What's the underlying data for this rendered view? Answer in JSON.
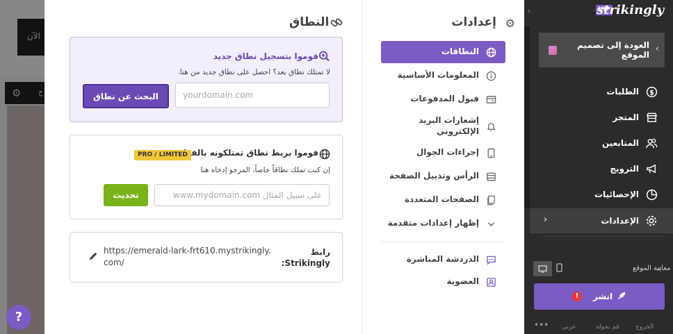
{
  "background": {
    "now_text": "الآن",
    "side_text": "ح"
  },
  "help": {
    "label": "?"
  },
  "settings": {
    "title": "إعدادات",
    "nav": [
      {
        "label": "النطاقات",
        "icon": "globe-icon",
        "active": true
      },
      {
        "label": "المعلومات الأساسية",
        "icon": "info-icon"
      },
      {
        "label": "قبول المدفوعات",
        "icon": "card-icon"
      },
      {
        "label": "إشعارات البريد الإلكتروني",
        "icon": "bell-icon"
      },
      {
        "label": "إجراءات الجوال",
        "icon": "mobile-icon"
      },
      {
        "label": "الرأس وتذييل الصفحة",
        "icon": "layout-icon"
      },
      {
        "label": "الصفحات المتعددة",
        "icon": "pages-icon"
      },
      {
        "label": "إظهار إعدادات متقدمة",
        "icon": "chevron-down-icon"
      },
      {
        "label": "الدردشة المباشرة",
        "icon": "chat-icon"
      },
      {
        "label": "العضوية",
        "icon": "member-icon"
      }
    ]
  },
  "domain": {
    "title": "النطاق",
    "register": {
      "heading": "قوموا بتسجيل نطاق جديد",
      "subtitle": "لا تمتلك نطاق بعد؟ احصل على نطاق جديد من هنا.",
      "placeholder": "yourdomain.com",
      "button": "البحث عن نطاق"
    },
    "connect": {
      "heading": "قوموا بربط نطاق تمتلكونه بالفعل",
      "badge": "PRO / LIMITED",
      "subtitle": "إن كنت تملك نطاقاً خاصاً، المرجو إدخاه هنا",
      "placeholder": "على سبيل المثال www.mydomain.com",
      "button": "تحديث"
    },
    "strikingly": {
      "label": "رابط Strikingly:",
      "url": "https://emerald-lark-frt610.mystrikingly.com/"
    }
  },
  "sidebar": {
    "brand": "strikingly",
    "vip": "VIP",
    "back": "العودة إلى تصميم الموقع",
    "items": [
      {
        "label": "الطلبات",
        "icon": "dollar-icon"
      },
      {
        "label": "المتجر",
        "icon": "store-icon"
      },
      {
        "label": "المتابعين",
        "icon": "users-icon"
      },
      {
        "label": "الترويج",
        "icon": "megaphone-icon"
      },
      {
        "label": "الإحصائيات",
        "icon": "chart-icon"
      },
      {
        "label": "الإعدادات",
        "icon": "gear-icon"
      }
    ],
    "preview": "معاينة الموقع",
    "publish": "انشر",
    "publish_warning": "!",
    "footer": [
      "الخروج",
      "قم بجولة",
      "عربي"
    ]
  }
}
